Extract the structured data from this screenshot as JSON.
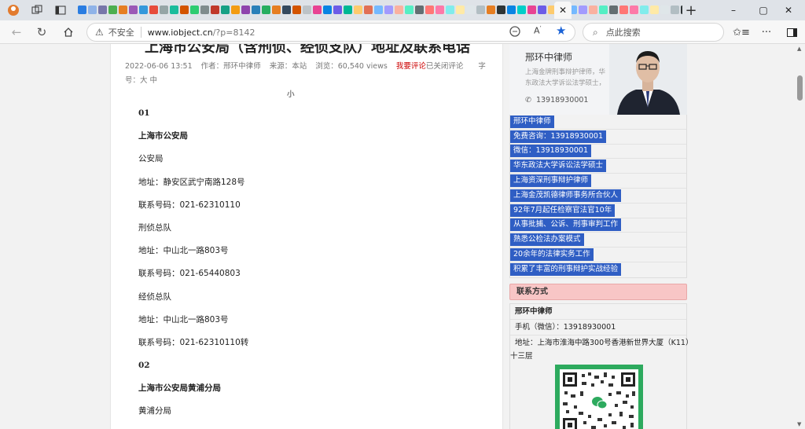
{
  "browser": {
    "active_tab_close": "✕",
    "new_tab": "+",
    "window": {
      "minimize": "–",
      "maximize": "▢",
      "close": "✕"
    },
    "address": {
      "security_label": "不安全",
      "url_host": "www.iobject.cn",
      "url_path": "/?p=8142"
    },
    "search_placeholder": "点此搜索",
    "tab_favicon_colors": [
      "#2a7de1",
      "#8fb3e8",
      "#77a",
      "#4caf50",
      "#e67e22",
      "#9b59b6",
      "#3498db",
      "#e74c3c",
      "#95a5a6",
      "#1abc9c",
      "#d35400",
      "#2ecc71",
      "#7f8c8d",
      "#c0392b",
      "#16a085",
      "#f39c12",
      "#8e44ad",
      "#2980b9",
      "#27ae60",
      "#e67e22",
      "#34495e",
      "#d35400",
      "#bdc3c7",
      "#e84393",
      "#0984e3",
      "#6c5ce7",
      "#00b894",
      "#fdcb6e",
      "#e17055",
      "#74b9ff",
      "#a29bfe",
      "#fab1a0",
      "#55efc4",
      "#636e72",
      "#ff7675",
      "#fd79a8",
      "#81ecec",
      "#ffeaa7",
      "#dfe6e9",
      "#b2bec3",
      "#e67e22",
      "#2d3436",
      "#0984e3",
      "#00cec9",
      "#e84393",
      "#6c5ce7",
      "#fdcb6e",
      "#d63031",
      "#74b9ff",
      "#a29bfe",
      "#fab1a0",
      "#55efc4",
      "#636e72",
      "#ff7675",
      "#fd79a8",
      "#81ecec",
      "#ffeaa7",
      "#dfe6e9",
      "#b2bec3",
      "#2d3436",
      "#0984e3",
      "#00cec9",
      "#e84393",
      "#6c5ce7"
    ]
  },
  "article": {
    "title": "上海市公安局（含刑侦、经侦支队）地址及联系电话",
    "meta": {
      "date": "2022-06-06 13:51",
      "author": "作者：邢环中律师",
      "source": "来源：本站",
      "views": "浏览：60,540 views",
      "comment_link": "我要评论",
      "comments_closed": "已关闭评论",
      "font_size_label": "字号：大 中",
      "font_size_small": "小"
    },
    "lines": [
      {
        "text": "01",
        "bold": true
      },
      {
        "text": "上海市公安局",
        "bold": true
      },
      {
        "text": "公安局",
        "bold": false
      },
      {
        "text": "地址：静安区武宁南路128号",
        "bold": false
      },
      {
        "text": "联系号码：021-62310110",
        "bold": false
      },
      {
        "text": "刑侦总队",
        "bold": false
      },
      {
        "text": "地址：中山北一路803号",
        "bold": false
      },
      {
        "text": "联系号码：021-65440803",
        "bold": false
      },
      {
        "text": "经侦总队",
        "bold": false
      },
      {
        "text": "地址：中山北一路803号",
        "bold": false
      },
      {
        "text": "联系号码：021-62310110转",
        "bold": false
      },
      {
        "text": "02",
        "bold": true
      },
      {
        "text": "上海市公安局黄浦分局",
        "bold": true
      },
      {
        "text": "黄浦分局",
        "bold": false
      }
    ]
  },
  "sidebar": {
    "profile": {
      "name": "邢环中律师",
      "desc": "上海金牌刑事辩护律师，华东政法大学诉讼法学硕士，",
      "phone": "13918930001"
    },
    "tags": [
      "邢环中律师",
      "免费咨询：13918930001",
      "微信：13918930001",
      "华东政法大学诉讼法学硕士",
      "上海资深刑事辩护律师",
      "上海金茂凯德律师事务所合伙人",
      "92年7月起任检察官法官10年",
      "从事批捕、公诉、刑事审判工作",
      "熟悉公检法办案模式",
      "20余年的法律实务工作",
      "积累了丰富的刑事辩护实战经验"
    ],
    "contact": {
      "heading": "联系方式",
      "name": "邢环中律师",
      "mobile": "手机（微信）：13918930001",
      "address": "地址：上海市淮海中路300号香港新世界大厦（K11）",
      "address_tail": "十三层"
    }
  }
}
